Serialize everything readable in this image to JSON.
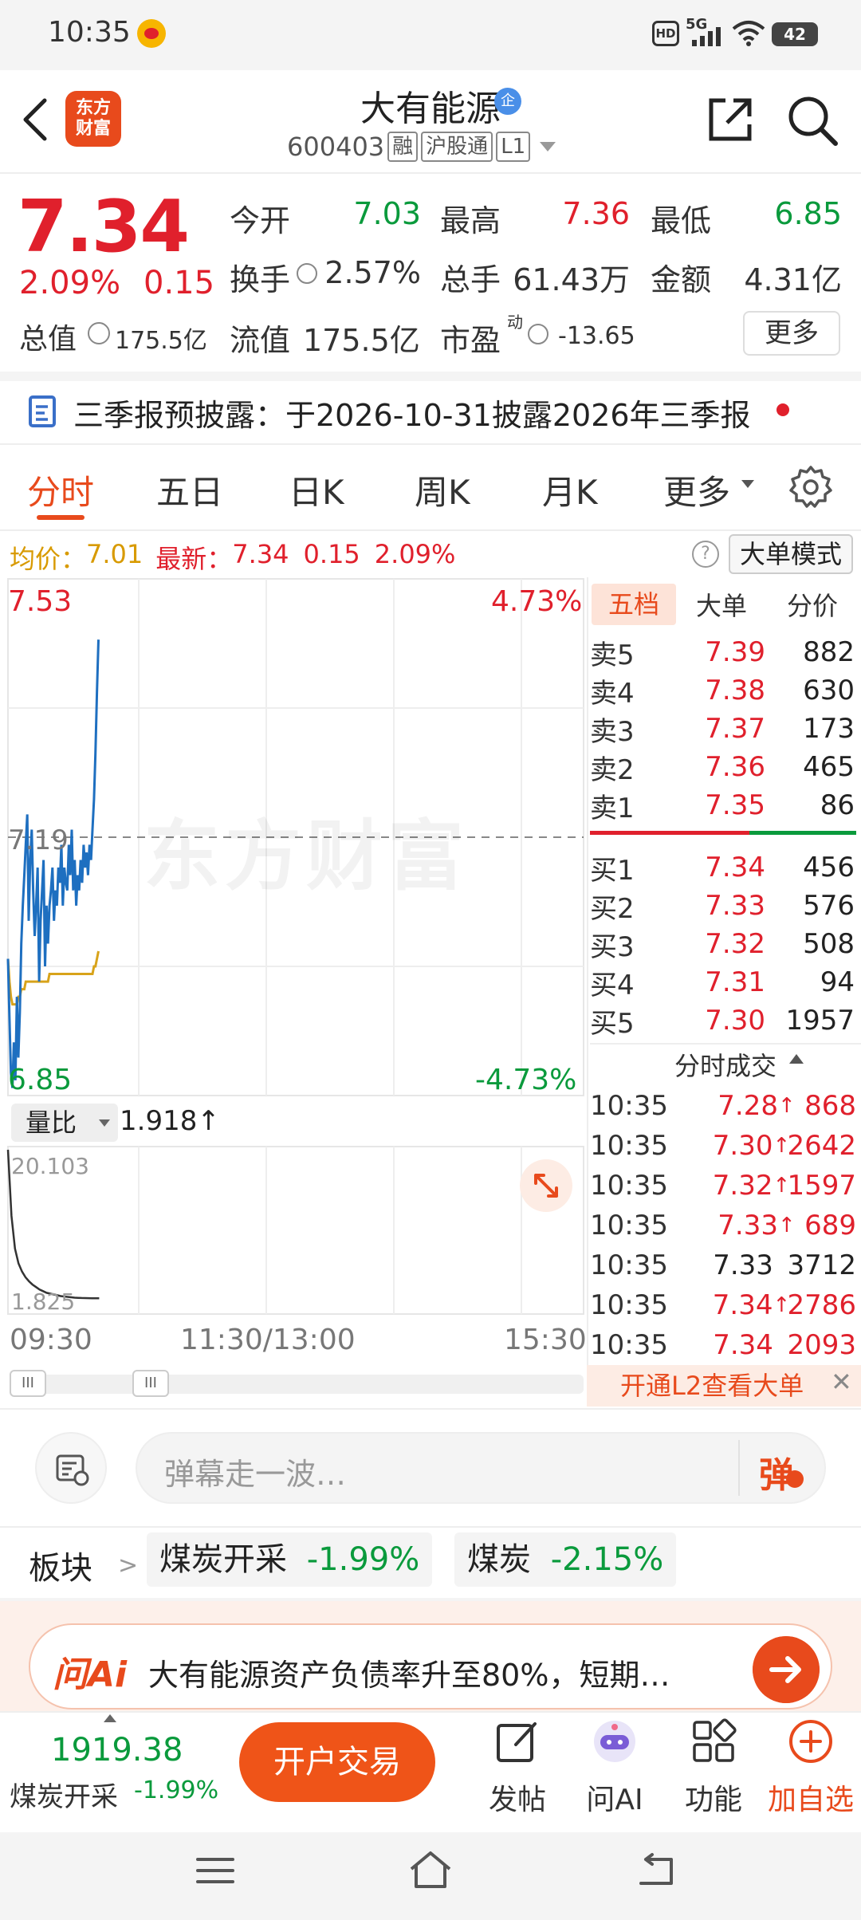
{
  "status_bar": {
    "time": "10:35",
    "network": "5G",
    "battery": "42",
    "hd": "HD"
  },
  "header": {
    "logo_line1": "东方",
    "logo_line2": "财富",
    "name": "大有能源",
    "badge": "企",
    "code": "600403",
    "tag_margin": "融",
    "tag_connect": "沪股通",
    "tag_level": "L1"
  },
  "quote": {
    "price": "7.34",
    "change_pct": "2.09%",
    "change_abs": "0.15",
    "open_label": "今开",
    "open": "7.03",
    "high_label": "最高",
    "high": "7.36",
    "low_label": "最低",
    "low": "6.85",
    "turnover_label": "换手",
    "turnover": "2.57%",
    "volume_label": "总手",
    "volume": "61.43万",
    "amount_label": "金额",
    "amount": "4.31亿",
    "mktcap_label": "总值",
    "mktcap": "175.5亿",
    "float_label": "流值",
    "float": "175.5亿",
    "pe_label": "市盈",
    "pe_sup": "动",
    "pe": "-13.65",
    "more": "更多"
  },
  "announcement": "三季报预披露：于2026-10-31披露2026年三季报",
  "tabs": [
    "分时",
    "五日",
    "日K",
    "周K",
    "月K",
    "更多"
  ],
  "info_line": {
    "avg_label": "均价：",
    "avg": "7.01",
    "latest_label": "最新：",
    "latest": "7.34",
    "chg": "0.15",
    "pct": "2.09%",
    "big_mode": "大单模式",
    "help": "?"
  },
  "chart": {
    "y_top": "7.53",
    "y_top_pct": "4.73%",
    "y_mid": "7.19",
    "y_bot": "6.85",
    "y_bot_pct": "-4.73%",
    "watermark": "东方财富",
    "vol_ratio_label": "量比",
    "vol_ratio": "1.918↑",
    "vol_max": "20.103",
    "vol_min": "1.825",
    "time_start": "09:30",
    "time_mid": "11:30/13:00",
    "time_end": "15:30",
    "scroll_handle": "III"
  },
  "chart_data": {
    "type": "line",
    "ylim": [
      6.85,
      7.53
    ],
    "series": [
      {
        "values": [
          7.03,
          6.95,
          6.88,
          6.86,
          6.92,
          6.87,
          6.98,
          6.9,
          6.96,
          7.05,
          7.1,
          7.14,
          7.18,
          7.22,
          7.08,
          7.16,
          7.2,
          7.12,
          7.06,
          7.1,
          7.15,
          7.0,
          7.08,
          7.12,
          7.16,
          7.02,
          7.1,
          7.05,
          7.1,
          7.12,
          7.15,
          7.08,
          7.12,
          7.1,
          7.15,
          7.13,
          7.18,
          7.1,
          7.15,
          7.13,
          7.12,
          7.18,
          7.14,
          7.2,
          7.12,
          7.16,
          7.1,
          7.14,
          7.12,
          7.16,
          7.13,
          7.18,
          7.15,
          7.17,
          7.14,
          7.18,
          7.16,
          7.2,
          7.24,
          7.3,
          7.38,
          7.45
        ]
      },
      {
        "values": [
          7.03,
          7.0,
          6.98,
          6.97,
          6.97,
          6.97,
          6.97,
          6.98,
          6.98,
          6.99,
          6.99,
          6.99,
          7.0,
          7.0,
          7.0,
          7.0,
          7.0,
          7.0,
          7.0,
          7.0,
          7.0,
          7.0,
          7.0,
          7.0,
          7.0,
          7.0,
          7.0,
          7.0,
          7.01,
          7.01,
          7.01,
          7.01,
          7.01,
          7.01,
          7.01,
          7.01,
          7.01,
          7.01,
          7.01,
          7.01,
          7.01,
          7.01,
          7.01,
          7.01,
          7.01,
          7.01,
          7.01,
          7.01,
          7.01,
          7.01,
          7.01,
          7.01,
          7.01,
          7.01,
          7.01,
          7.01,
          7.01,
          7.01,
          7.02,
          7.02,
          7.03,
          7.04
        ]
      }
    ],
    "volume_ratio": [
      20.103,
      12.0,
      8.0,
      6.2,
      5.2,
      4.5,
      4.0,
      3.6,
      3.3,
      3.0,
      2.8,
      2.6,
      2.5,
      2.4,
      2.3,
      2.2,
      2.15,
      2.1,
      2.05,
      2.0,
      1.98,
      1.96,
      1.95,
      1.94,
      1.93,
      1.92,
      1.918
    ]
  },
  "order_book": {
    "tabs": [
      "五档",
      "大单",
      "分价"
    ],
    "sell": [
      {
        "label": "卖5",
        "price": "7.39",
        "vol": "882"
      },
      {
        "label": "卖4",
        "price": "7.38",
        "vol": "630"
      },
      {
        "label": "卖3",
        "price": "7.37",
        "vol": "173"
      },
      {
        "label": "卖2",
        "price": "7.36",
        "vol": "465"
      },
      {
        "label": "卖1",
        "price": "7.35",
        "vol": "86"
      }
    ],
    "buy": [
      {
        "label": "买1",
        "price": "7.34",
        "vol": "456"
      },
      {
        "label": "买2",
        "price": "7.33",
        "vol": "576"
      },
      {
        "label": "买3",
        "price": "7.32",
        "vol": "508"
      },
      {
        "label": "买4",
        "price": "7.31",
        "vol": "94"
      },
      {
        "label": "买5",
        "price": "7.30",
        "vol": "1957"
      }
    ]
  },
  "trades": {
    "title": "分时成交",
    "rows": [
      {
        "time": "10:35",
        "price": "7.28",
        "arrow": "↑",
        "vol": "868",
        "color": "#e0202c"
      },
      {
        "time": "10:35",
        "price": "7.30",
        "arrow": "↑",
        "vol": "2642",
        "color": "#e0202c"
      },
      {
        "time": "10:35",
        "price": "7.32",
        "arrow": "↑",
        "vol": "1597",
        "color": "#e0202c"
      },
      {
        "time": "10:35",
        "price": "7.33",
        "arrow": "↑",
        "vol": "689",
        "color": "#e0202c"
      },
      {
        "time": "10:35",
        "price": "7.33",
        "arrow": "",
        "vol": "3712",
        "color": "#222222"
      },
      {
        "time": "10:35",
        "price": "7.34",
        "arrow": "↑",
        "vol": "2786",
        "color": "#e0202c"
      },
      {
        "time": "10:35",
        "price": "7.34",
        "arrow": "",
        "vol": "2093",
        "color": "#e0202c"
      }
    ],
    "l2_banner": "开通L2查看大单",
    "close": "✕"
  },
  "comment": {
    "placeholder": "弹幕走一波…",
    "send": "弹"
  },
  "sectors": {
    "label": "板块",
    "items": [
      {
        "name": "煤炭开采",
        "chg": "-1.99%"
      },
      {
        "name": "煤炭",
        "chg": "-2.15%"
      }
    ]
  },
  "ai_banner": {
    "logo": "问Ai",
    "text": "大有能源资产负债率升至80%，短期…"
  },
  "bottom_bar": {
    "index_value": "1919.38",
    "index_name": "煤炭开采",
    "index_chg": "-1.99%",
    "trade_button": "开户交易",
    "nav": [
      {
        "label": "发帖",
        "icon": "edit-icon"
      },
      {
        "label": "问AI",
        "icon": "ai-avatar-icon"
      },
      {
        "label": "功能",
        "icon": "grid-icon"
      },
      {
        "label": "加自选",
        "icon": "plus-circle-icon"
      }
    ]
  },
  "colors": {
    "up": "#e0202c",
    "down": "#0a9a3c",
    "accent": "#e84a1c"
  }
}
